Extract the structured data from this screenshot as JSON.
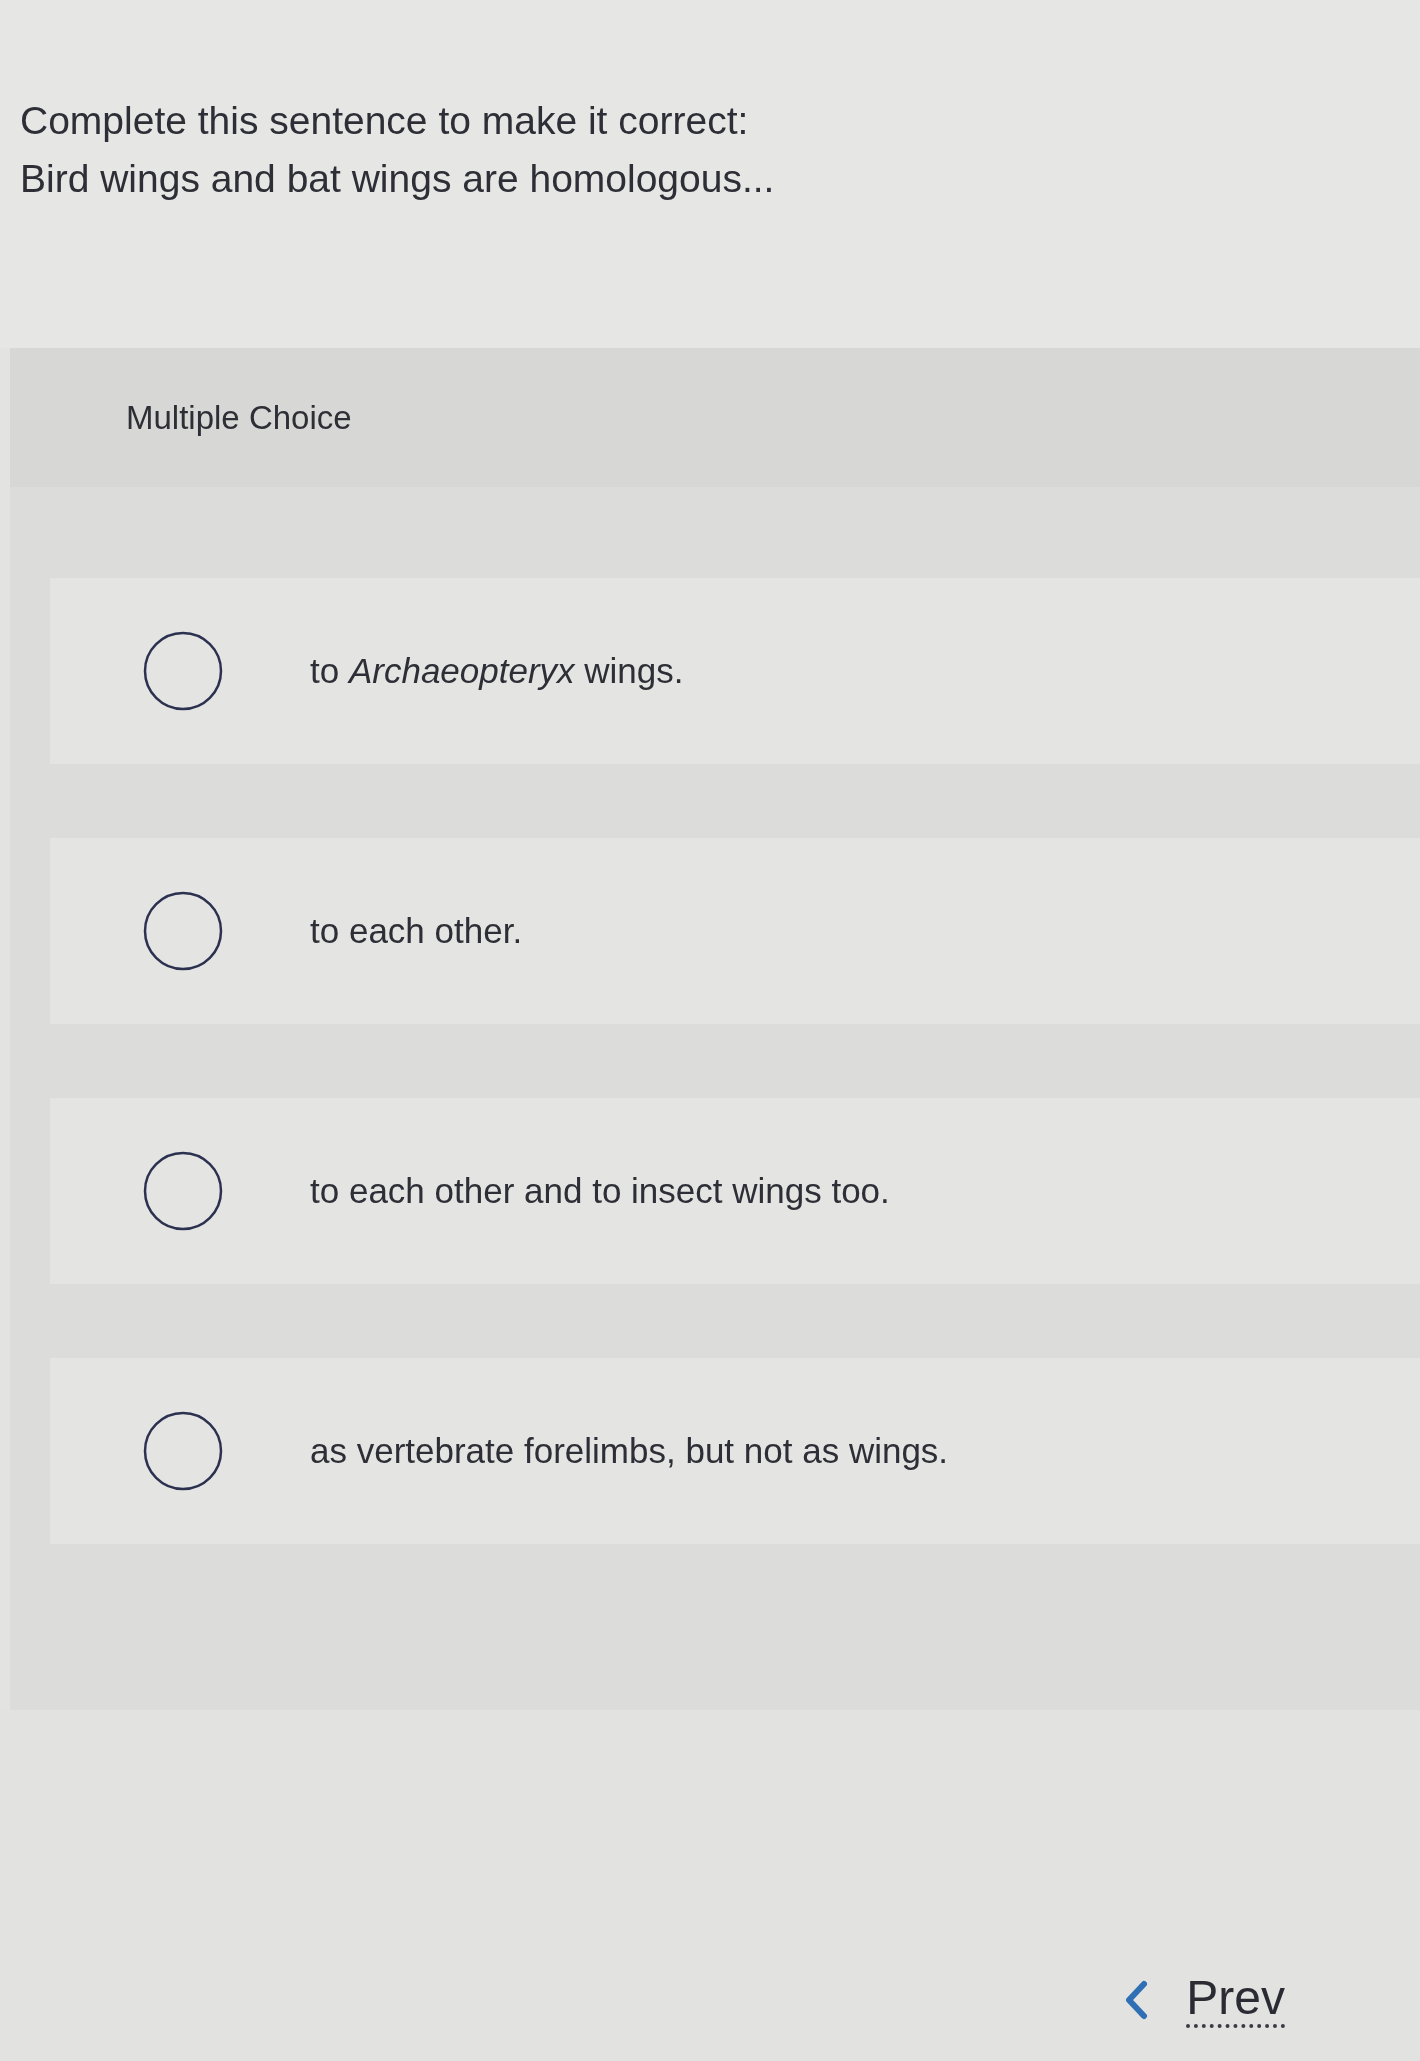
{
  "question": {
    "prompt": "Complete this sentence to make it correct:",
    "stem": "Bird wings and bat wings are homologous..."
  },
  "answer_panel": {
    "heading": "Multiple Choice",
    "options": [
      {
        "text": "to *Archaeopteryx* wings.",
        "selected": false
      },
      {
        "text": "to each other.",
        "selected": false
      },
      {
        "text": "to each other and to insect wings too.",
        "selected": false
      },
      {
        "text": "as vertebrate forelimbs, but not as wings.",
        "selected": false
      }
    ]
  },
  "navigation": {
    "prev": "Prev"
  }
}
